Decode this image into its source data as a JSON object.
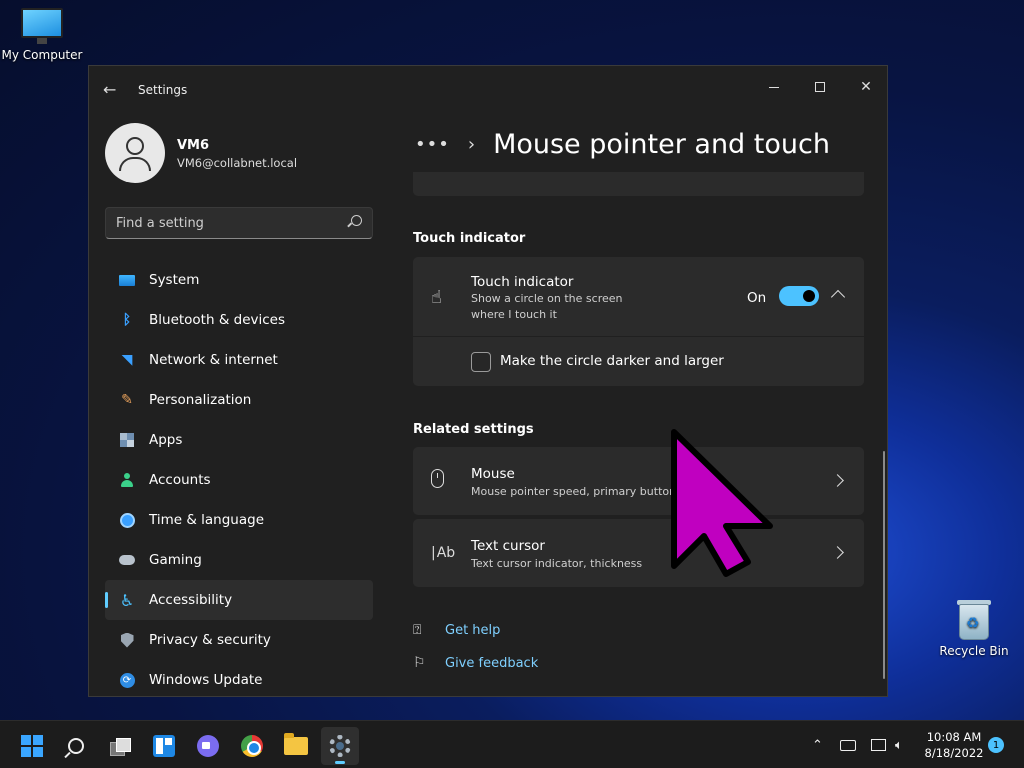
{
  "desktop": {
    "icons": [
      {
        "label": "My Computer"
      },
      {
        "label": "Recycle Bin"
      }
    ]
  },
  "window": {
    "app_title": "Settings",
    "back_icon": "back-arrow-icon",
    "controls": [
      "minimize-icon",
      "maximize-icon",
      "close-icon"
    ]
  },
  "user": {
    "name": "VM6",
    "email": "VM6@collabnet.local"
  },
  "search": {
    "placeholder": "Find a setting",
    "icon": "search-icon"
  },
  "nav": {
    "items": [
      {
        "label": "System",
        "icon": "system-icon"
      },
      {
        "label": "Bluetooth & devices",
        "icon": "bluetooth-icon"
      },
      {
        "label": "Network & internet",
        "icon": "wifi-icon"
      },
      {
        "label": "Personalization",
        "icon": "brush-icon"
      },
      {
        "label": "Apps",
        "icon": "apps-icon"
      },
      {
        "label": "Accounts",
        "icon": "person-icon"
      },
      {
        "label": "Time & language",
        "icon": "clock-globe-icon"
      },
      {
        "label": "Gaming",
        "icon": "controller-icon"
      },
      {
        "label": "Accessibility",
        "icon": "accessibility-icon"
      },
      {
        "label": "Privacy & security",
        "icon": "shield-icon"
      },
      {
        "label": "Windows Update",
        "icon": "update-icon"
      }
    ],
    "active": "Accessibility",
    "accent": "#60cdff"
  },
  "header": {
    "breadcrumb_overflow": "•••",
    "page_title": "Mouse pointer and touch"
  },
  "touch_section": {
    "title": "Touch indicator",
    "card": {
      "title": "Touch indicator",
      "subtitle": "Show a circle on the screen where I touch it",
      "icon": "touch-hand-icon",
      "toggle_label": "On",
      "toggle_on": true,
      "expanded": true,
      "option": {
        "label": "Make the circle darker and larger",
        "checked": false
      }
    }
  },
  "related_section": {
    "title": "Related settings",
    "items": [
      {
        "title": "Mouse",
        "subtitle": "Mouse pointer speed, primary button",
        "icon": "mouse-icon"
      },
      {
        "title": "Text cursor",
        "subtitle": "Text cursor indicator, thickness",
        "icon": "text-cursor-icon"
      }
    ]
  },
  "help_links": [
    {
      "label": "Get help",
      "icon": "help-icon"
    },
    {
      "label": "Give feedback",
      "icon": "feedback-icon"
    }
  ],
  "pointer_overlay": {
    "color": "#c000c0"
  },
  "taskbar": {
    "apps": [
      "start-icon",
      "search-icon",
      "task-view-icon",
      "widgets-icon",
      "chat-icon",
      "chrome-icon",
      "file-explorer-icon",
      "settings-icon"
    ],
    "active_app": "settings-icon",
    "clock_time": "10:08 AM",
    "clock_date": "8/18/2022",
    "notification_count": "1"
  }
}
